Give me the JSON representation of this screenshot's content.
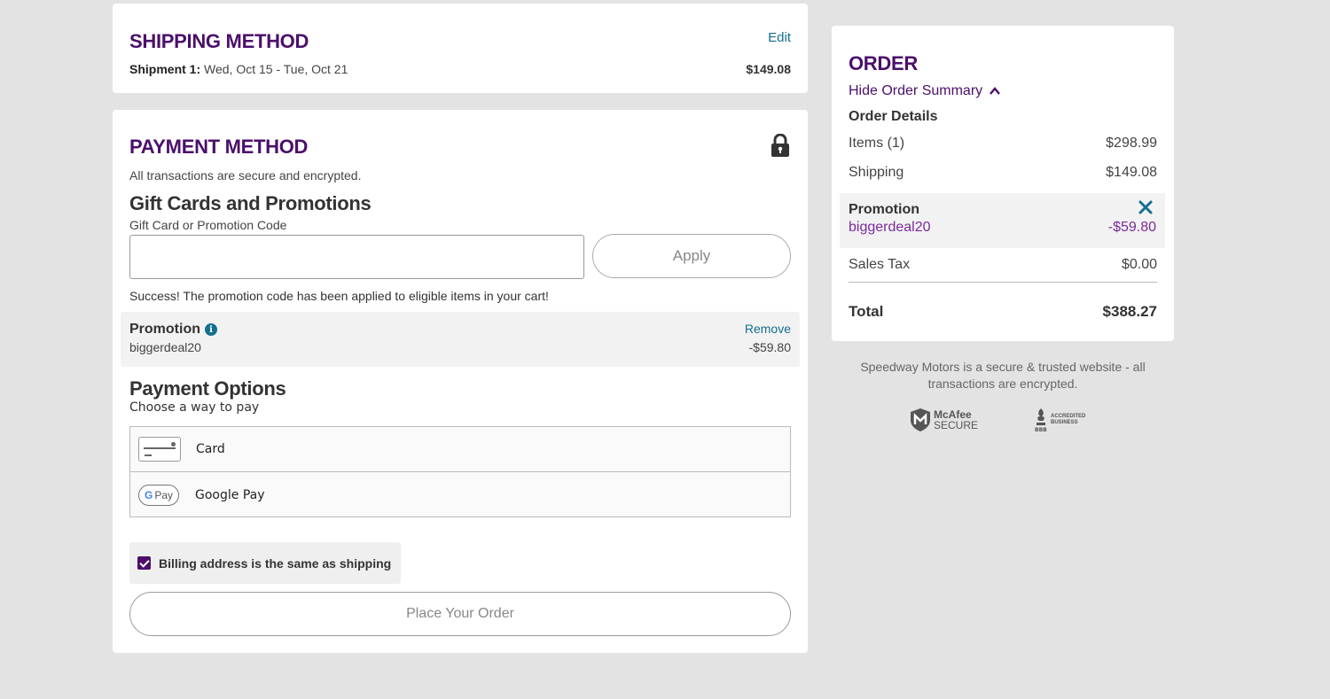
{
  "shipping": {
    "title": "SHIPPING METHOD",
    "edit_label": "Edit",
    "shipment_label": "Shipment 1:",
    "shipment_dates": " Wed, Oct 15 - Tue, Oct 21",
    "shipment_price": "$149.08"
  },
  "payment": {
    "title": "PAYMENT METHOD",
    "lock_icon": "lock-icon",
    "secure_note": "All transactions are secure and encrypted.",
    "gift": {
      "title": "Gift Cards and Promotions",
      "label": "Gift Card or Promotion Code",
      "value": "",
      "placeholder": "",
      "apply_label": "Apply",
      "success_message": "Success! The promotion code has been applied to eligible items in your cart!"
    },
    "promo": {
      "label": "Promotion",
      "info_icon": "info-icon",
      "code": "biggerdeal20",
      "remove_label": "Remove",
      "amount": "-$59.80"
    },
    "options": {
      "title": "Payment Options",
      "subtitle": "Choose a way to pay",
      "items": [
        {
          "icon": "credit-card-icon",
          "label": "Card"
        },
        {
          "icon": "google-pay-icon",
          "label": "Google Pay"
        }
      ]
    },
    "billing_same": {
      "checked": true,
      "label": "Billing address is the same as shipping"
    },
    "place_order_label": "Place Your Order"
  },
  "order": {
    "title": "ORDER",
    "hide_summary_label": "Hide Order Summary",
    "details_title": "Order Details",
    "items_label": "Items (1)",
    "items_value": "$298.99",
    "shipping_label": "Shipping",
    "shipping_value": "$149.08",
    "promo_label": "Promotion",
    "promo_code": "biggerdeal20",
    "promo_amount": "-$59.80",
    "tax_label": "Sales Tax",
    "tax_value": "$0.00",
    "total_label": "Total",
    "total_value": "$388.27"
  },
  "trust": {
    "message": "Speedway Motors is a secure & trusted website - all transactions are encrypted.",
    "mcafee_line1": "McAfee",
    "mcafee_line2": "SECURE",
    "bbb_line1": "ACCREDITED",
    "bbb_line2": "BUSINESS"
  },
  "colors": {
    "brand_purple": "#4b0f6b",
    "link_teal": "#136f8f",
    "promo_purple": "#7a2a9a",
    "page_bg": "#e3e3e3"
  }
}
